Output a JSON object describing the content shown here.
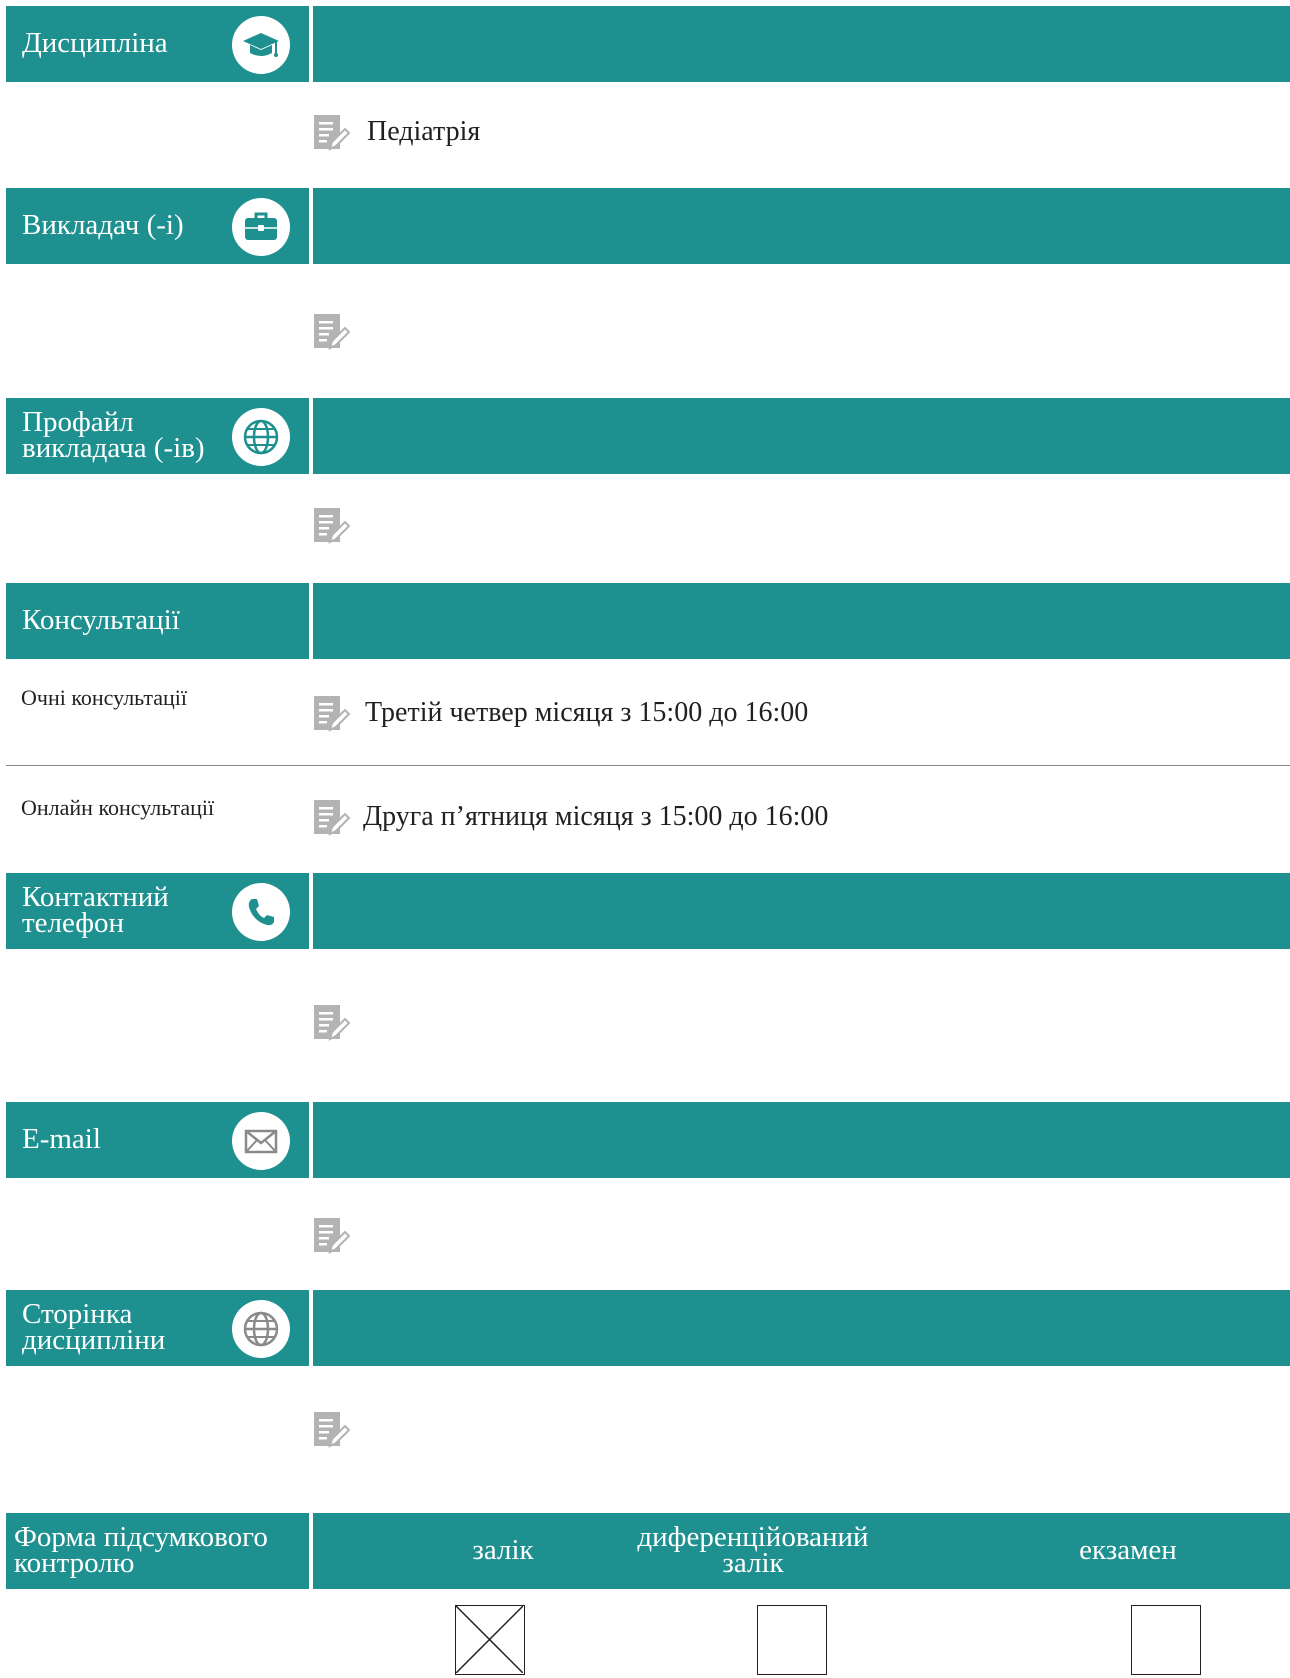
{
  "sections": {
    "discipline": {
      "title": "Дисципліна",
      "icon": "graduation-cap-icon",
      "value": "Педіатрія"
    },
    "teacher": {
      "title": "Викладач (-і)",
      "icon": "briefcase-icon",
      "value": ""
    },
    "profile": {
      "title_line1": "Профайл",
      "title_line2": "викладача (-ів)",
      "icon": "globe-icon",
      "value": ""
    },
    "consultations": {
      "title": "Консультації",
      "rows": [
        {
          "label": "Очні консультації",
          "value": "Третій четвер місяця з 15:00 до 16:00"
        },
        {
          "label": "Онлайн консультації",
          "value": "Друга п’ятниця місяця з 15:00 до 16:00"
        }
      ]
    },
    "phone": {
      "title_line1": "Контактний",
      "title_line2": "телефон",
      "icon": "phone-icon",
      "value": ""
    },
    "email": {
      "title": "E-mail",
      "icon": "envelope-icon",
      "value": ""
    },
    "course_page": {
      "title_line1": "Сторінка",
      "title_line2": "дисципліни",
      "icon": "globe-icon",
      "value": ""
    },
    "final_control": {
      "title_line1": "Форма підсумкового",
      "title_line2": "контролю",
      "options": [
        {
          "label_line1": "залік",
          "label_line2": "",
          "checked": true
        },
        {
          "label_line1": "диференційований",
          "label_line2": "залік",
          "checked": false
        },
        {
          "label_line1": "екзамен",
          "label_line2": "",
          "checked": false
        }
      ]
    }
  },
  "colors": {
    "header_bg": "#1e908f",
    "header_text": "#ffffff",
    "icon_gray": "#b3b3b3"
  }
}
